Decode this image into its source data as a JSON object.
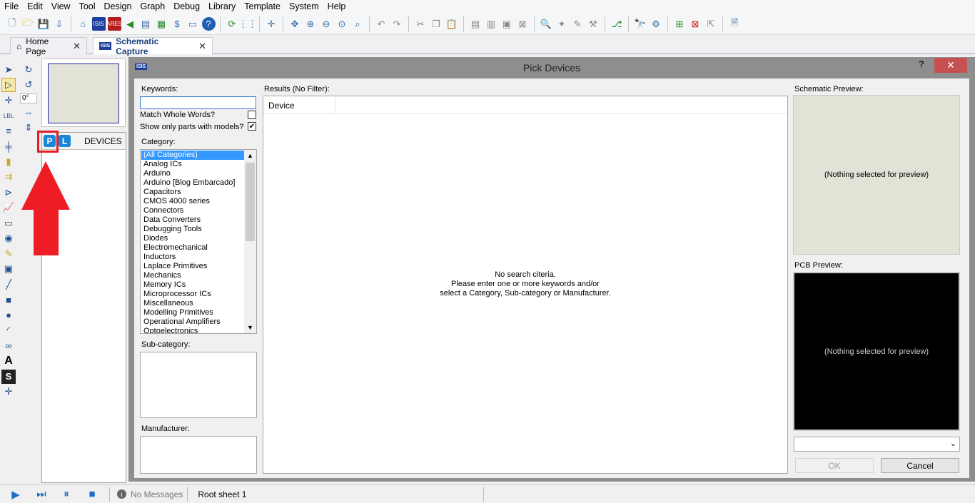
{
  "menu": [
    "File",
    "Edit",
    "View",
    "Tool",
    "Design",
    "Graph",
    "Debug",
    "Library",
    "Template",
    "System",
    "Help"
  ],
  "tabs": {
    "home": "Home Page",
    "schematic": "Schematic Capture"
  },
  "leftpanel": {
    "rotation": "0°",
    "p_label": "P",
    "l_label": "L",
    "devices_title": "DEVICES"
  },
  "dialog": {
    "logo": "ISIS",
    "title": "Pick Devices",
    "help": "?",
    "close": "✕",
    "keywords_label": "Keywords:",
    "keywords_value": "",
    "match_whole_words": "Match Whole Words?",
    "match_whole_words_checked": false,
    "show_only_models": "Show only parts with models?",
    "show_only_models_checked": true,
    "category_label": "Category:",
    "categories": [
      "(All Categories)",
      "Analog ICs",
      "Arduino",
      "Arduino [Blog Embarcado]",
      "Capacitors",
      "CMOS 4000 series",
      "Connectors",
      "Data Converters",
      "Debugging Tools",
      "Diodes",
      "Electromechanical",
      "Inductors",
      "Laplace Primitives",
      "Mechanics",
      "Memory ICs",
      "Microprocessor ICs",
      "Miscellaneous",
      "Modelling Primitives",
      "Operational Amplifiers",
      "Optoelectronics"
    ],
    "subcategory_label": "Sub-category:",
    "manufacturer_label": "Manufacturer:",
    "results_label": "Results (No Filter):",
    "results_column": "Device",
    "no_search_1": "No search citeria.",
    "no_search_2": "Please enter one or more keywords and/or",
    "no_search_3": "select a Category, Sub-category or Manufacturer.",
    "schematic_preview_label": "Schematic Preview:",
    "pcb_preview_label": "PCB Preview:",
    "nothing_selected": "(Nothing selected for preview)",
    "ok": "OK",
    "cancel": "Cancel"
  },
  "status": {
    "messages": "No Messages",
    "sheet": "Root sheet 1"
  }
}
